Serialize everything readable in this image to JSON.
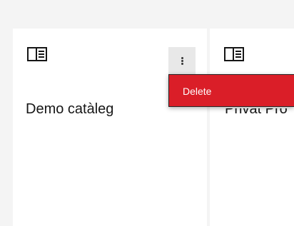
{
  "cards": [
    {
      "title": "Demo catàleg",
      "icon": "catalog-icon"
    },
    {
      "title": "Privat Pro",
      "icon": "catalog-icon"
    }
  ],
  "overflow_menu": {
    "icon": "overflow-menu-vertical-icon",
    "items": [
      {
        "label": "Delete",
        "color": "#da1e28"
      }
    ]
  },
  "colors": {
    "danger": "#da1e28",
    "background": "#f4f4f4",
    "card": "#ffffff"
  }
}
